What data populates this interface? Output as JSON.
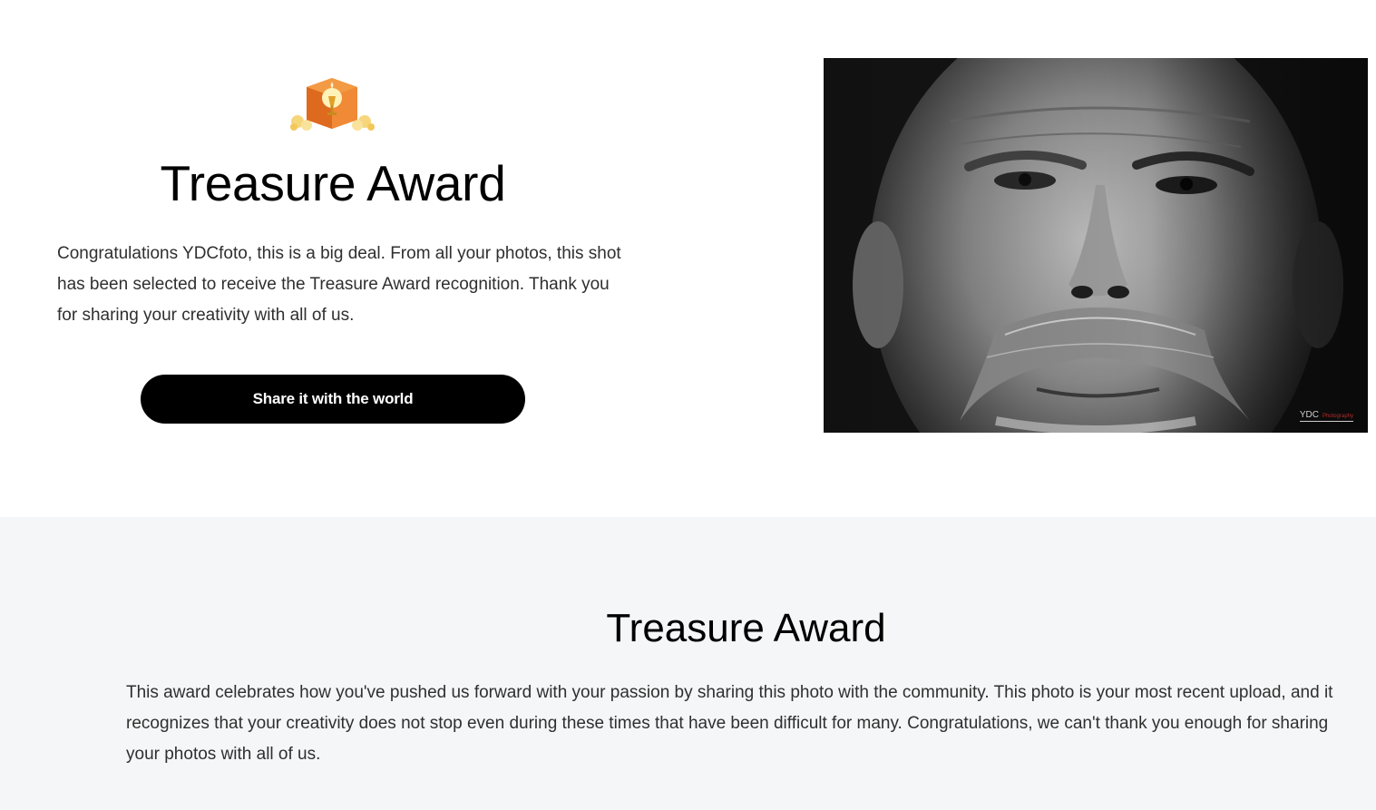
{
  "hero": {
    "badge_icon": "treasure-chest-icon",
    "title": "Treasure Award",
    "message": "Congratulations YDCfoto, this is a big deal. From all your photos, this shot has been selected to receive the Treasure Award recognition. Thank you for sharing your creativity with all of us.",
    "share_button_label": "Share it with the world",
    "photo_alt": "Black and white close-up portrait of a man with a mustache",
    "photo_watermark": "YDC",
    "photo_watermark_sub": "Photography"
  },
  "info": {
    "title": "Treasure Award",
    "description": "This award celebrates how you've pushed us forward with your passion by sharing this photo with the community. This photo is your most recent upload, and it recognizes that your creativity does not stop even during these times that have been difficult for many. Congratulations, we can't thank you enough for sharing your photos with all of us."
  },
  "colors": {
    "button_bg": "#000000",
    "button_text": "#ffffff",
    "info_bg": "#f5f6f7",
    "badge_orange": "#e8792b"
  }
}
